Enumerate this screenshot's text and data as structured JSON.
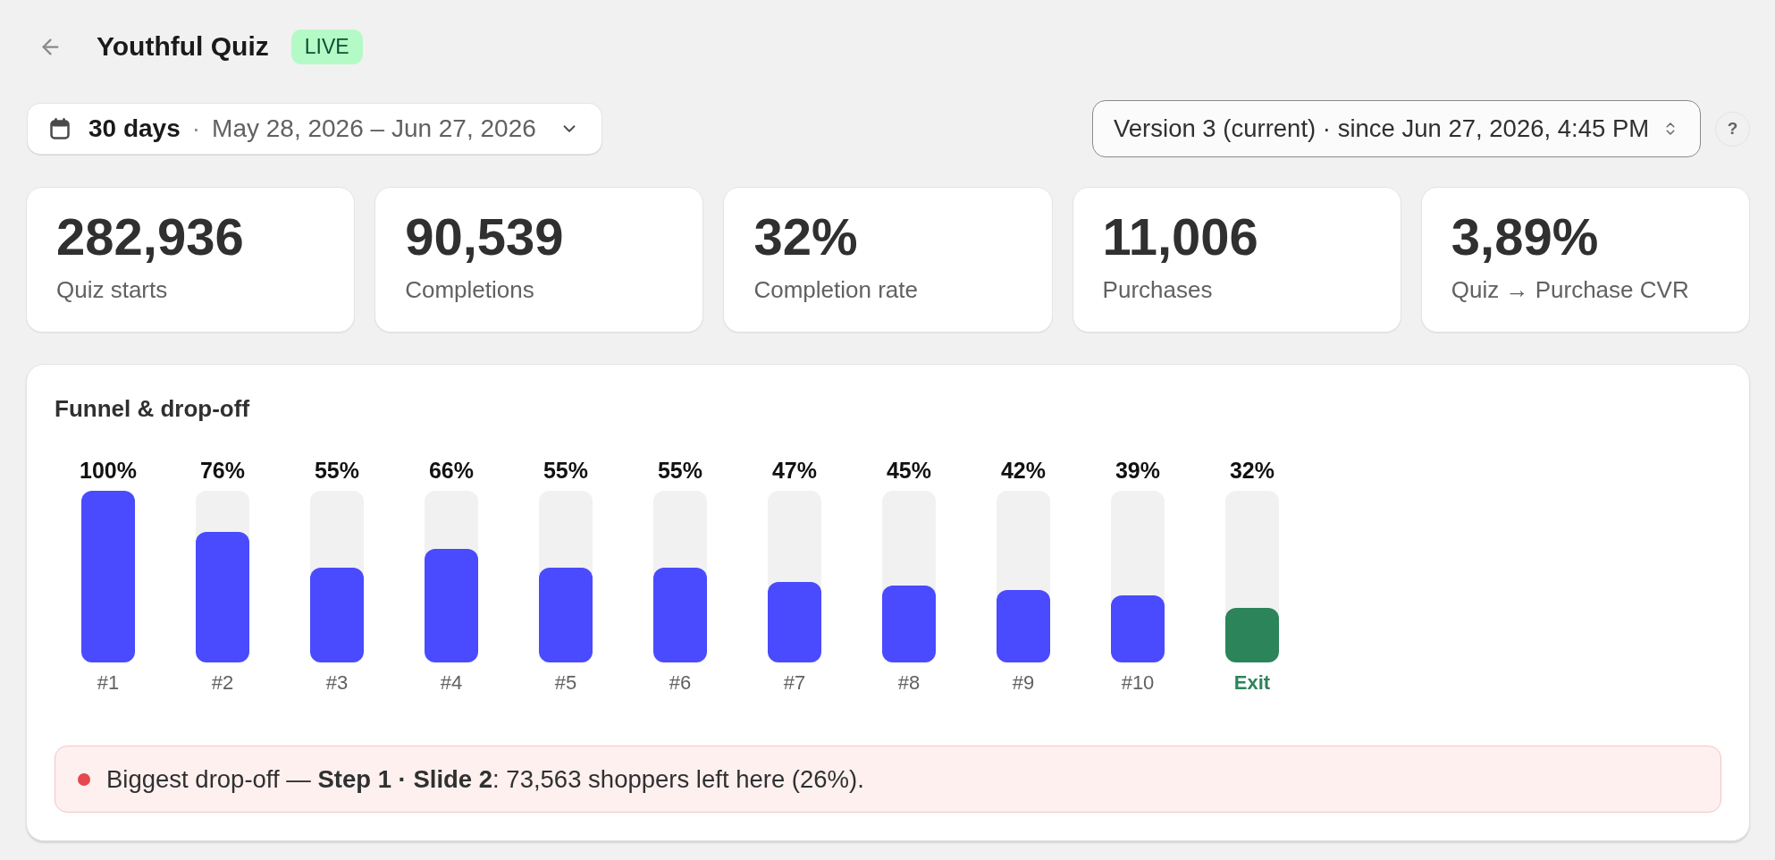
{
  "header": {
    "title": "Youthful Quiz",
    "status_badge": "LIVE"
  },
  "date_range": {
    "preset": "30 days",
    "separator": "·",
    "range": "May 28, 2026 – Jun 27, 2026"
  },
  "version_select": {
    "value": "Version 3 (current) · since Jun 27, 2026, 4:45 PM"
  },
  "help_button": "?",
  "stats": [
    {
      "value": "282,936",
      "label": "Quiz starts"
    },
    {
      "value": "90,539",
      "label": "Completions"
    },
    {
      "value": "32%",
      "label": "Completion rate"
    },
    {
      "value": "11,006",
      "label": "Purchases"
    },
    {
      "value": "3,89%",
      "label": "Quiz → Purchase CVR"
    }
  ],
  "funnel": {
    "title": "Funnel & drop-off",
    "steps": [
      {
        "kind": "step",
        "value": "100%",
        "level": 1,
        "label": "#1"
      },
      {
        "kind": "step",
        "value": "76%",
        "level": 0.76,
        "label": "#2"
      },
      {
        "kind": "step",
        "value": "55%",
        "level": 0.55,
        "label": "#3"
      },
      {
        "kind": "step",
        "value": "66%",
        "level": 0.66,
        "label": "#4"
      },
      {
        "kind": "step",
        "value": "55%",
        "level": 0.55,
        "label": "#5"
      },
      {
        "kind": "step",
        "value": "55%",
        "level": 0.55,
        "label": "#6"
      },
      {
        "kind": "step",
        "value": "47%",
        "level": 0.47,
        "label": "#7"
      },
      {
        "kind": "step",
        "value": "45%",
        "level": 0.45,
        "label": "#8"
      },
      {
        "kind": "step",
        "value": "42%",
        "level": 0.42,
        "label": "#9"
      },
      {
        "kind": "step",
        "value": "39%",
        "level": 0.39,
        "label": "#10"
      },
      {
        "kind": "exit",
        "value": "32%",
        "level": 0.32,
        "label": "Exit"
      }
    ],
    "alert": {
      "text": "Biggest drop-off — **Step 1 · Slide 2**: 73,563 shoppers left here (26%)."
    }
  }
}
